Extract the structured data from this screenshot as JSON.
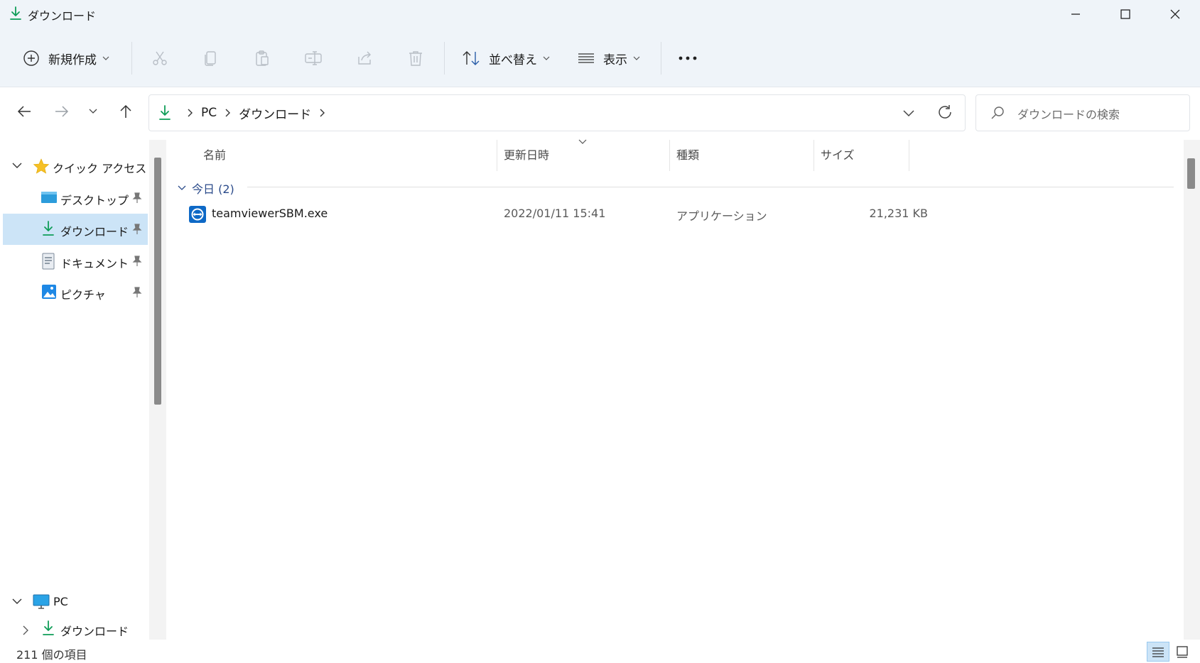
{
  "window": {
    "title": "ダウンロード"
  },
  "commandbar": {
    "new_label": "新規作成",
    "sort_label": "並べ替え",
    "view_label": "表示"
  },
  "addressbar": {
    "crumbs": [
      "PC",
      "ダウンロード"
    ],
    "search_placeholder": "ダウンロードの検索"
  },
  "sidebar": {
    "quick_access": "クイック アクセス",
    "items": [
      {
        "label": "デスクトップ",
        "icon": "desktop-folder-icon"
      },
      {
        "label": "ダウンロード",
        "icon": "download-icon",
        "selected": true
      },
      {
        "label": "ドキュメント",
        "icon": "document-icon"
      },
      {
        "label": "ピクチャ",
        "icon": "pictures-icon"
      }
    ],
    "pc": "PC",
    "pc_child": "ダウンロード"
  },
  "columns": {
    "name": "名前",
    "date": "更新日時",
    "type": "種類",
    "size": "サイズ"
  },
  "group": {
    "label": "今日 (2)"
  },
  "files": [
    {
      "name": "teamviewerSBM.exe",
      "date": "2022/01/11 15:41",
      "type": "アプリケーション",
      "size": "21,231 KB",
      "icon": "teamviewer-icon"
    }
  ],
  "status": {
    "count": "211 個の項目"
  },
  "colors": {
    "accent": "#0078d4",
    "download_green": "#0f9d58",
    "selection": "#cce4f7",
    "chrome": "#eff4f9"
  }
}
